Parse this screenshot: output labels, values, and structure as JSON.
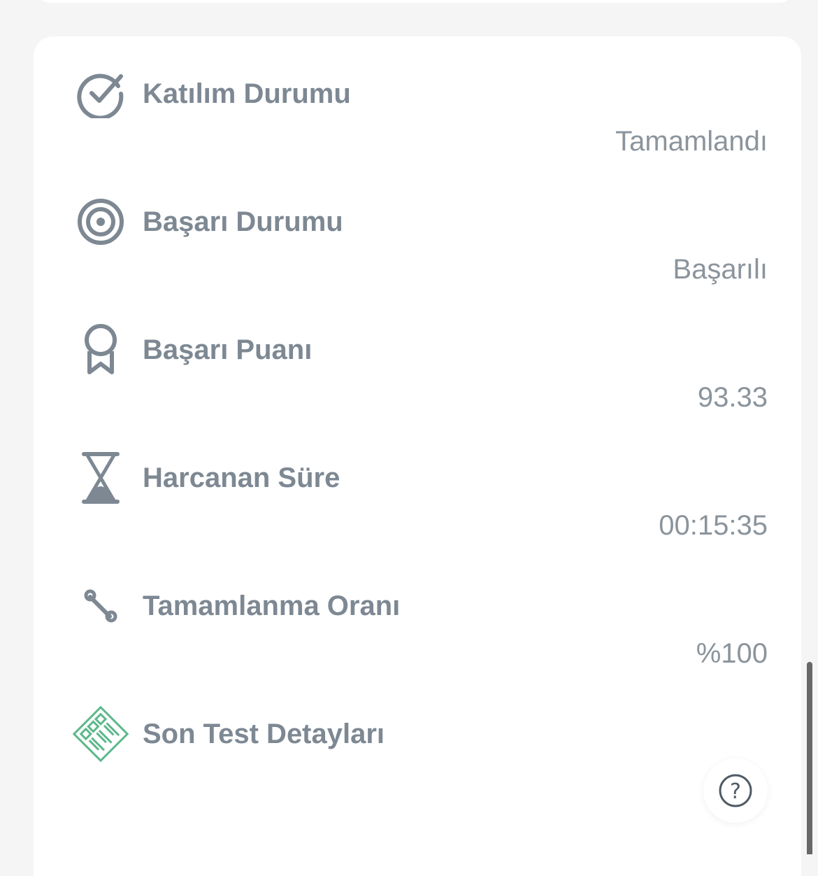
{
  "colors": {
    "page_background": "#f5f5f5",
    "card_background": "#ffffff",
    "label_color": "#7d8893",
    "value_color": "#8b949c",
    "icon_color": "#7d8893",
    "accent_green": "#5cb88a",
    "help_icon_color": "#4f5b66"
  },
  "details": {
    "rows": [
      {
        "label": "Katılım Durumu",
        "value": "Tamamlandı",
        "icon": "check-circle-icon"
      },
      {
        "label": "Başarı Durumu",
        "value": "Başarılı",
        "icon": "target-icon"
      },
      {
        "label": "Başarı Puanı",
        "value": "93.33",
        "icon": "award-ribbon-icon"
      },
      {
        "label": "Harcanan Süre",
        "value": "00:15:35",
        "icon": "hourglass-icon"
      },
      {
        "label": "Tamamlanma Oranı",
        "value": "%100",
        "icon": "percent-icon"
      },
      {
        "label": "Son Test Detayları",
        "value": "",
        "icon": "test-details-icon"
      }
    ]
  },
  "help": {
    "icon": "question-circle-icon",
    "glyph": "?"
  }
}
